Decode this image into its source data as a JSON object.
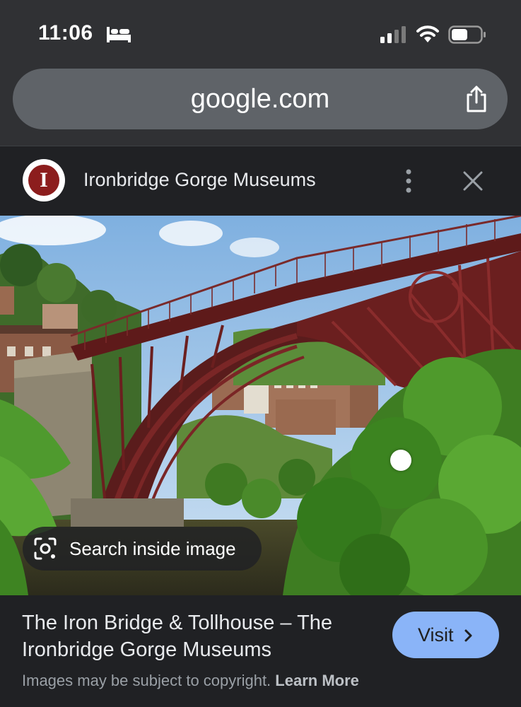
{
  "status_bar": {
    "time": "11:06",
    "icons": [
      "bed-icon",
      "signal-icon",
      "wifi-icon",
      "battery-icon"
    ]
  },
  "browser": {
    "address": "google.com",
    "share_icon": "share-icon"
  },
  "source": {
    "logo_letter": "I",
    "name": "Ironbridge Gorge Museums",
    "menu_icon": "more-vertical-icon",
    "close_icon": "close-icon"
  },
  "image": {
    "search_inside_label": "Search inside image",
    "search_icon": "lens-icon"
  },
  "result": {
    "title": "The Iron Bridge & Tollhouse – The Ironbridge Gorge Museums",
    "visit_label": "Visit",
    "copyright_text": "Images may be subject to copyright.",
    "learn_more": "Learn More"
  },
  "colors": {
    "background": "#202124",
    "toolbar": "#303134",
    "address_pill": "#5f6368",
    "visit_button": "#8ab4f8",
    "logo_red": "#8c1d1d",
    "bridge_red": "#6b1f1f"
  }
}
